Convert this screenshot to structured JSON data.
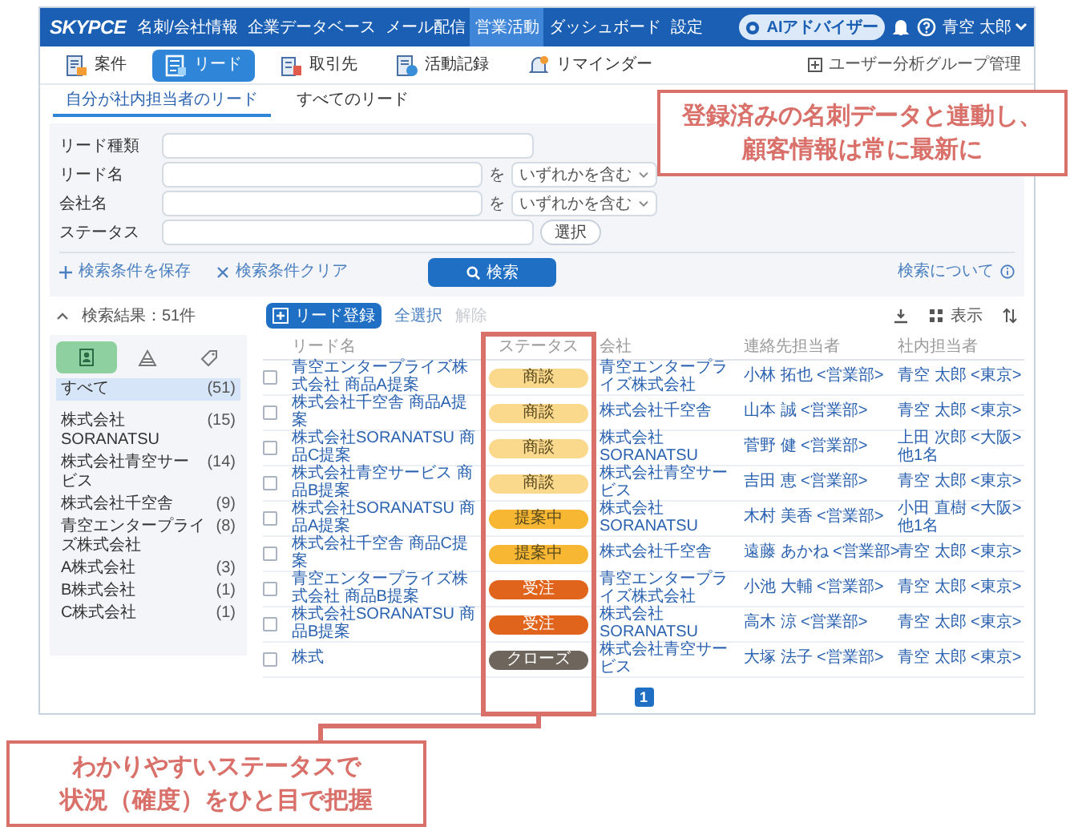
{
  "app": {
    "logo": "SKYPCE",
    "ai_button": "AIアドバイザー",
    "user": "青空 太郎"
  },
  "nav": [
    {
      "label": "名刺/会社情報",
      "selected": false
    },
    {
      "label": "企業データベース",
      "selected": false
    },
    {
      "label": "メール配信",
      "selected": false
    },
    {
      "label": "営業活動",
      "selected": true
    },
    {
      "label": "ダッシュボード",
      "selected": false
    },
    {
      "label": "設定",
      "selected": false
    }
  ],
  "module_tabs": [
    {
      "label": "案件",
      "selected": false
    },
    {
      "label": "リード",
      "selected": true
    },
    {
      "label": "取引先",
      "selected": false
    },
    {
      "label": "活動記録",
      "selected": false
    },
    {
      "label": "リマインダー",
      "selected": false
    }
  ],
  "group_admin_link": "ユーザー分析グループ管理",
  "view_tabs": [
    {
      "label": "自分が社内担当者のリード",
      "selected": true
    },
    {
      "label": "すべてのリード",
      "selected": false
    }
  ],
  "search": {
    "fields": [
      {
        "label": "リード種類",
        "kind": "text"
      },
      {
        "label": "リード名",
        "kind": "text_match",
        "suffix": "を",
        "match_mode": "いずれかを含む"
      },
      {
        "label": "会社名",
        "kind": "text_match",
        "suffix": "を",
        "match_mode": "いずれかを含む"
      },
      {
        "label": "ステータス",
        "kind": "picker",
        "button": "選択"
      }
    ],
    "save_link": "検索条件を保存",
    "clear_link": "検索条件クリア",
    "search_button": "検索",
    "help_link": "検索について"
  },
  "results": {
    "count": "検索結果：51件",
    "add_button": "リード登録",
    "select_all": "全選択",
    "deselect": {
      "label": "解除",
      "disabled": true
    },
    "display_button": "表示"
  },
  "filter_tabs": [
    {
      "selected": true
    },
    {
      "selected": false
    },
    {
      "selected": false
    }
  ],
  "companies": [
    {
      "name": "すべて",
      "count": "(51)",
      "selected": true
    },
    {
      "name": "株式会社SORANATSU",
      "count": "(15)",
      "selected": false
    },
    {
      "name": "株式会社青空サービス",
      "count": "(14)",
      "selected": false
    },
    {
      "name": "株式会社千空舎",
      "count": "(9)",
      "selected": false
    },
    {
      "name": "青空エンタープライズ株式会社",
      "count": "(8)",
      "selected": false
    },
    {
      "name": "A株式会社",
      "count": "(3)",
      "selected": false
    },
    {
      "name": "B株式会社",
      "count": "(1)",
      "selected": false
    },
    {
      "name": "C株式会社",
      "count": "(1)",
      "selected": false
    }
  ],
  "table": {
    "columns": [
      "リード名",
      "ステータス",
      "会社",
      "連絡先担当者",
      "社内担当者"
    ],
    "rows": [
      {
        "checked": false,
        "lead": "青空エンタープライズ株式会社 商品A提案",
        "status": {
          "label": "商談",
          "color": "#fbd98c"
        },
        "company": "青空エンタープライズ株式会社",
        "contact": "小林 拓也 <営業部>",
        "internal": "青空 太郎 <東京>"
      },
      {
        "checked": false,
        "lead": "株式会社千空舎 商品A提案",
        "status": {
          "label": "商談",
          "color": "#fbd98c"
        },
        "company": "株式会社千空舎",
        "contact": "山本 誠 <営業部>",
        "internal": "青空 太郎 <東京>"
      },
      {
        "checked": false,
        "lead": "株式会社SORANATSU 商品C提案",
        "status": {
          "label": "商談",
          "color": "#fbd98c"
        },
        "company": "株式会社SORANATSU",
        "contact": "菅野 健 <営業部>",
        "internal": "上田 次郎 <大阪>",
        "internal_more": "他1名"
      },
      {
        "checked": false,
        "lead": "株式会社青空サービス 商品B提案",
        "status": {
          "label": "商談",
          "color": "#fbd98c"
        },
        "company": "株式会社青空サービス",
        "contact": "吉田 恵 <営業部>",
        "internal": "青空 太郎 <東京>"
      },
      {
        "checked": false,
        "lead": "株式会社SORANATSU 商品A提案",
        "status": {
          "label": "提案中",
          "color": "#f7b733"
        },
        "company": "株式会社SORANATSU",
        "contact": "木村 美香 <営業部>",
        "internal": "小田 直樹 <大阪>",
        "internal_more": "他1名"
      },
      {
        "checked": false,
        "lead": "株式会社千空舎 商品C提案",
        "status": {
          "label": "提案中",
          "color": "#f7b733"
        },
        "company": "株式会社千空舎",
        "contact": "遠藤 あかね <営業部>",
        "internal": "青空 太郎 <東京>"
      },
      {
        "checked": false,
        "lead": "青空エンタープライズ株式会社 商品B提案",
        "status": {
          "label": "受注",
          "color": "#e0641c"
        },
        "company": "青空エンタープライズ株式会社",
        "contact": "小池 大輔 <営業部>",
        "internal": "青空 太郎 <東京>"
      },
      {
        "checked": false,
        "lead": "株式会社SORANATSU 商品B提案",
        "status": {
          "label": "受注",
          "color": "#e0641c"
        },
        "company": "株式会社SORANATSU",
        "contact": "高木 涼 <営業部>",
        "internal": "青空 太郎 <東京>"
      },
      {
        "checked": false,
        "lead": "株式",
        "status": {
          "label": "クローズ",
          "color": "#6e665d"
        },
        "company": "株式会社青空サービス",
        "contact": "大塚 法子 <営業部>",
        "internal": "青空 太郎 <東京>"
      }
    ]
  },
  "pagination": [
    {
      "label": "1",
      "selected": true
    }
  ],
  "callouts": [
    {
      "lines": [
        "登録済みの名刺データと連動し、",
        "顧客情報は常に最新に"
      ]
    },
    {
      "lines": [
        "わかりやすいステータスで",
        "状況（確度）をひと目で把握"
      ]
    }
  ]
}
